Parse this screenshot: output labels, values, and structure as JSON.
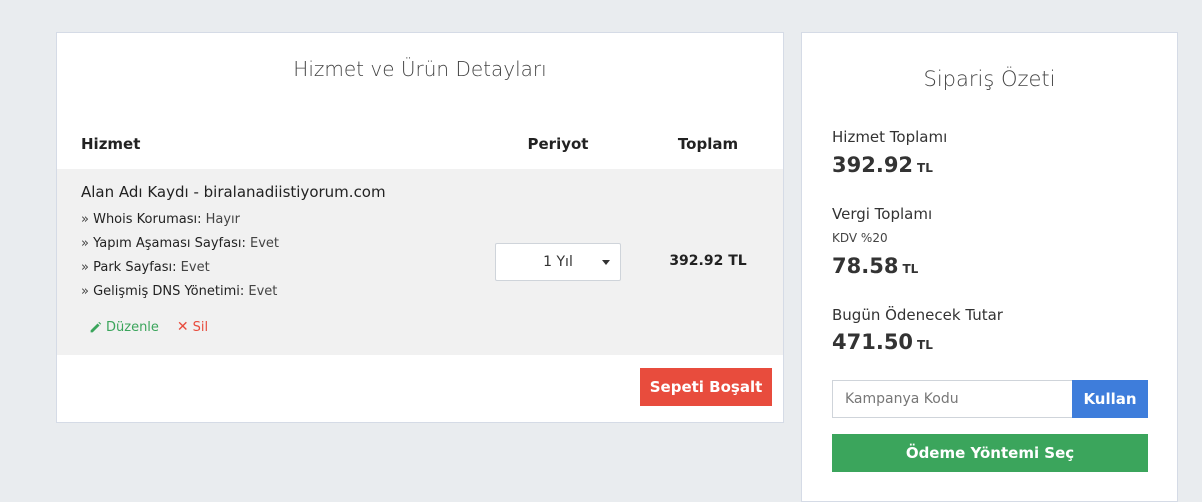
{
  "cart": {
    "title": "Hizmet ve Ürün Detayları",
    "columns": {
      "service": "Hizmet",
      "period": "Periyot",
      "total": "Toplam"
    },
    "item": {
      "name": "Alan Adı Kaydı - biralanadiistiyorum.com",
      "details": [
        {
          "prefix": "» ",
          "key": "Whois Koruması:",
          "value": " Hayır"
        },
        {
          "prefix": "» ",
          "key": "Yapım Aşaması Sayfası:",
          "value": " Evet"
        },
        {
          "prefix": "» ",
          "key": "Park Sayfası:",
          "value": " Evet"
        },
        {
          "prefix": "» ",
          "key": "Gelişmiş DNS Yönetimi:",
          "value": " Evet"
        }
      ],
      "edit_label": "Düzenle",
      "delete_label": "Sil",
      "period_value": "1 Yıl",
      "total": "392.92 TL"
    },
    "empty_button": "Sepeti Boşalt"
  },
  "summary": {
    "title": "Sipariş Özeti",
    "service_total_label": "Hizmet Toplamı",
    "service_total_value": "392.92",
    "tax_label": "Vergi Toplamı",
    "tax_sub": "KDV %20",
    "tax_value": "78.58",
    "due_label": "Bugün Ödenecek Tutar",
    "due_value": "471.50",
    "currency": "TL",
    "coupon_placeholder": "Kampanya Kodu",
    "apply_button": "Kullan",
    "pay_button": "Ödeme Yöntemi Seç"
  },
  "colors": {
    "danger": "#e84c3d",
    "success": "#3ba55c",
    "primary": "#3e7ddb"
  },
  "icons": {
    "edit": "pencil-icon",
    "delete": "close-icon",
    "select": "caret-down-icon"
  }
}
